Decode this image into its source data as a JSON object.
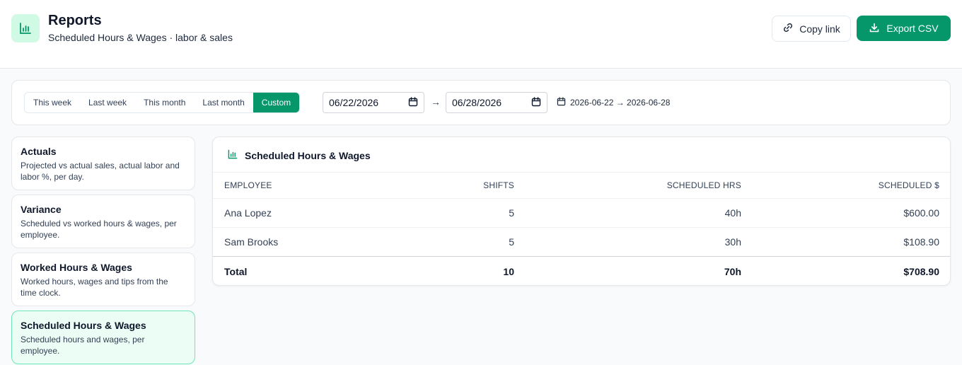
{
  "header": {
    "title": "Reports",
    "subtitle": "Scheduled Hours & Wages · labor & sales",
    "copy_label": "Copy link",
    "export_label": "Export CSV"
  },
  "filters": {
    "presets": [
      {
        "label": "This week",
        "active": false
      },
      {
        "label": "Last week",
        "active": false
      },
      {
        "label": "This month",
        "active": false
      },
      {
        "label": "Last month",
        "active": false
      },
      {
        "label": "Custom",
        "active": true
      }
    ],
    "from_date": "06/22/2026",
    "to_date": "06/28/2026",
    "arrow": "→",
    "range_label": "2026-06-22 → 2026-06-28"
  },
  "sidebar": {
    "items": [
      {
        "title": "Actuals",
        "desc": "Projected vs actual sales, actual labor and labor %, per day.",
        "active": false
      },
      {
        "title": "Variance",
        "desc": "Scheduled vs worked hours & wages, per employee.",
        "active": false
      },
      {
        "title": "Worked Hours & Wages",
        "desc": "Worked hours, wages and tips from the time clock.",
        "active": false
      },
      {
        "title": "Scheduled Hours & Wages",
        "desc": "Scheduled hours and wages, per employee.",
        "active": true
      }
    ]
  },
  "report": {
    "title": "Scheduled Hours & Wages",
    "columns": [
      "EMPLOYEE",
      "SHIFTS",
      "SCHEDULED HRS",
      "SCHEDULED $"
    ],
    "rows": [
      [
        "Ana Lopez",
        "5",
        "40h",
        "$600.00"
      ],
      [
        "Sam Brooks",
        "5",
        "30h",
        "$108.90"
      ]
    ],
    "total": [
      "Total",
      "10",
      "70h",
      "$708.90"
    ]
  },
  "colors": {
    "accent": "#059669",
    "accent_light": "#d1fae5",
    "active_card_bg": "#ecfdf5",
    "active_card_border": "#6ee7b7"
  },
  "icons": {
    "logo": "bar-chart-icon",
    "copy": "link-icon",
    "export": "download-icon",
    "date": "calendar-icon"
  }
}
